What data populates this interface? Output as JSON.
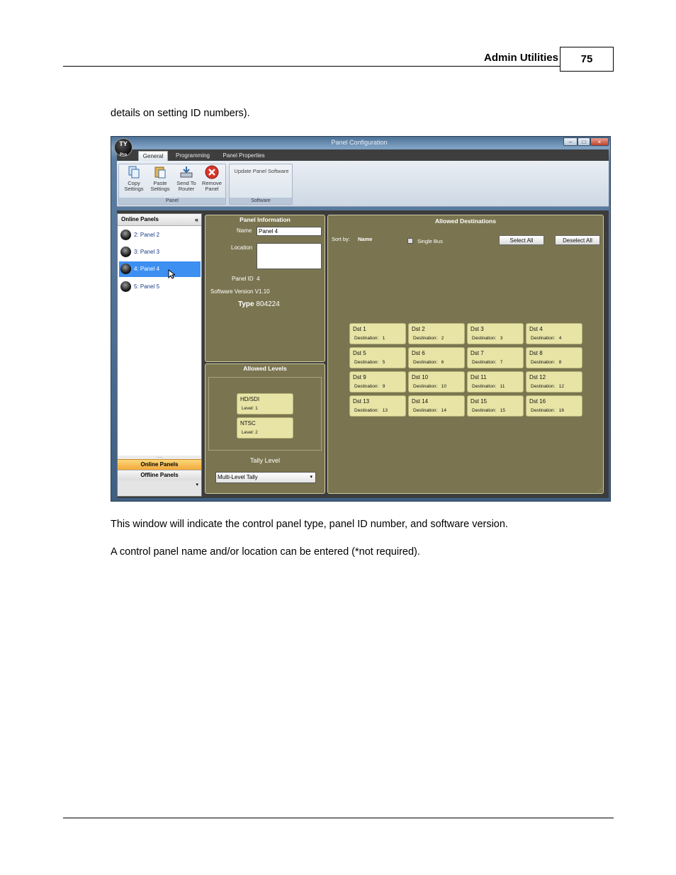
{
  "page": {
    "header_title": "Admin Utilities",
    "page_number": "75",
    "intro_text": "details on setting ID numbers).",
    "para1": "This window will indicate the control panel type, panel ID number, and software version.",
    "para2": "A control panel name and/or location can be entered (*not required)."
  },
  "window": {
    "title": "Panel Configuration",
    "logo_text": "TY",
    "logo_sub": "Pro",
    "controls": {
      "minimize": "–",
      "maximize": "□",
      "close": "×"
    }
  },
  "tabs": [
    "General",
    "Programming",
    "Panel Properties"
  ],
  "ribbon": {
    "panel_group_label": "Panel",
    "software_group_label": "Software",
    "buttons": [
      {
        "line1": "Copy",
        "line2": "Settings",
        "icon": "copy-settings-icon"
      },
      {
        "line1": "Paste",
        "line2": "Settings",
        "icon": "paste-settings-icon"
      },
      {
        "line1": "Send To",
        "line2": "Router",
        "icon": "send-to-router-icon"
      },
      {
        "line1": "Remove",
        "line2": "Panel",
        "icon": "remove-panel-icon"
      }
    ],
    "update_software": "Update Panel Software"
  },
  "left_panel": {
    "title": "Online Panels",
    "collapse": "«",
    "items": [
      "2: Panel 2",
      "3: Panel 3",
      "4: Panel 4",
      "5: Panel 5"
    ],
    "selected_index": 2,
    "grip": ".....",
    "online_button": "Online Panels",
    "offline_button": "Offline Panels",
    "more": "▾"
  },
  "panel_info": {
    "title": "Panel Information",
    "name_label": "Name",
    "name_value": "Panel 4",
    "location_label": "Location",
    "location_value": "",
    "panel_id_label": "Panel ID",
    "panel_id_value": "4",
    "software_version": "Software Version V1.10",
    "type_label": "Type",
    "type_value": "804224"
  },
  "allowed_levels": {
    "title": "Allowed Levels",
    "levels": [
      {
        "name": "HD/SDI",
        "level": "Level: 1"
      },
      {
        "name": "NTSC",
        "level": "Level: 2"
      }
    ],
    "tally_label": "Tally Level",
    "tally_value": "Multi-Level Tally"
  },
  "allowed_destinations": {
    "title": "Allowed Destinations",
    "sort_label": "Sort by:",
    "sort_value": "Name",
    "single_bus": "Single Bus",
    "select_all": "Select All",
    "deselect_all": "Deselect All",
    "destinations": [
      {
        "name": "Dst 1",
        "dest": "Destination:   1"
      },
      {
        "name": "Dst 2",
        "dest": "Destination:   2"
      },
      {
        "name": "Dst 3",
        "dest": "Destination:   3"
      },
      {
        "name": "Dst 4",
        "dest": "Destination:   4"
      },
      {
        "name": "Dst 5",
        "dest": "Destination:   5"
      },
      {
        "name": "Dst 6",
        "dest": "Destination:   6"
      },
      {
        "name": "Dst 7",
        "dest": "Destination:   7"
      },
      {
        "name": "Dst 8",
        "dest": "Destination:   8"
      },
      {
        "name": "Dst 9",
        "dest": "Destination:   9"
      },
      {
        "name": "Dst 10",
        "dest": "Destination:   10"
      },
      {
        "name": "Dst 11",
        "dest": "Destination:   11"
      },
      {
        "name": "Dst 12",
        "dest": "Destination:   12"
      },
      {
        "name": "Dst 13",
        "dest": "Destination:   13"
      },
      {
        "name": "Dst 14",
        "dest": "Destination:   14"
      },
      {
        "name": "Dst 15",
        "dest": "Destination:   15"
      },
      {
        "name": "Dst 16",
        "dest": "Destination:   16"
      }
    ]
  },
  "colors": {
    "panel_olive": "#7a7550",
    "card_fill": "#e8e4a6",
    "selection_blue": "#3d8ff2",
    "online_orange": "#f2a93b"
  }
}
